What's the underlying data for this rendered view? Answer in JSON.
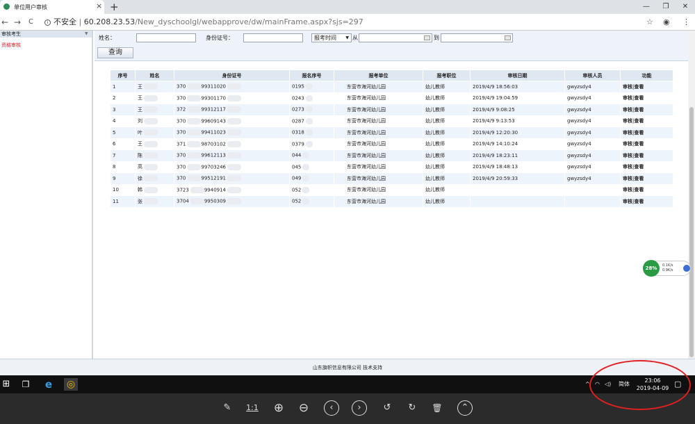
{
  "browser": {
    "tab_title": "单位用户审核",
    "tab_close": "×",
    "new_tab": "+",
    "window_controls": [
      "—",
      "❐",
      "✕"
    ],
    "nav": {
      "back": "←",
      "forward": "→",
      "reload": "C"
    },
    "security_label": "不安全",
    "url_host": "60.208.23.53",
    "url_path": "/New_dyschoolgl/webapprove/dw/mainFrame.aspx?sjs=297",
    "star": "☆",
    "account": "◉",
    "menu": "⋮"
  },
  "sidebar": {
    "header": "审核考生",
    "items": [
      {
        "label": "资格审核"
      }
    ]
  },
  "filters": {
    "name_label": "姓名：",
    "id_label": "身份证号：",
    "time_select": "报考时间",
    "from_label": "从",
    "to_label": "到",
    "query_button": "查询"
  },
  "table": {
    "columns": [
      "序号",
      "姓名",
      "身份证号",
      "报名序号",
      "报考单位",
      "报考职位",
      "审核日期",
      "审核人员",
      "功能"
    ],
    "rows": [
      {
        "no": "1",
        "name": "王",
        "id": "370",
        "id2": "99311020",
        "reg": "0195",
        "unit": "东营市海河幼儿园",
        "pos": "幼儿教师",
        "date": "2019/4/9 18:56:03",
        "auditor": "gwyzsdy4",
        "a1": "审核",
        "a2": "查看"
      },
      {
        "no": "2",
        "name": "王",
        "id": "370",
        "id2": "99301170",
        "reg": "0243",
        "unit": "东营市海河幼儿园",
        "pos": "幼儿教师",
        "date": "2019/4/9 19:04:59",
        "auditor": "gwyzsdy4",
        "a1": "审核",
        "a2": "查看"
      },
      {
        "no": "3",
        "name": "王",
        "id": "372",
        "id2": "99312117",
        "reg": "0273",
        "unit": "东营市海河幼儿园",
        "pos": "幼儿教师",
        "date": "2019/4/9 9:08:25",
        "auditor": "gwyzsdy4",
        "a1": "审核",
        "a2": "查看"
      },
      {
        "no": "4",
        "name": "刘",
        "id": "370",
        "id2": "99609143",
        "reg": "0287",
        "unit": "东营市海河幼儿园",
        "pos": "幼儿教师",
        "date": "2019/4/9 9:13:53",
        "auditor": "gwyzsdy4",
        "a1": "审核",
        "a2": "查看"
      },
      {
        "no": "5",
        "name": "叶",
        "id": "370",
        "id2": "99411023",
        "reg": "0318",
        "unit": "东营市海河幼儿园",
        "pos": "幼儿教师",
        "date": "2019/4/9 12:20:30",
        "auditor": "gwyzsdy4",
        "a1": "审核",
        "a2": "查看"
      },
      {
        "no": "6",
        "name": "王",
        "id": "371",
        "id2": "98703102",
        "reg": "0379",
        "unit": "东营市海河幼儿园",
        "pos": "幼儿教师",
        "date": "2019/4/9 14:10:24",
        "auditor": "gwyzsdy4",
        "a1": "审核",
        "a2": "查看"
      },
      {
        "no": "7",
        "name": "陈",
        "id": "370",
        "id2": "99612113",
        "reg": "044",
        "unit": "东营市海河幼儿园",
        "pos": "幼儿教师",
        "date": "2019/4/9 18:23:11",
        "auditor": "gwyzsdy4",
        "a1": "审核",
        "a2": "查看"
      },
      {
        "no": "8",
        "name": "高",
        "id": "370",
        "id2": "99703246",
        "reg": "045",
        "unit": "东营市海河幼儿园",
        "pos": "幼儿教师",
        "date": "2019/4/9 18:48:13",
        "auditor": "gwyzsdy4",
        "a1": "审核",
        "a2": "查看"
      },
      {
        "no": "9",
        "name": "徐",
        "id": "370",
        "id2": "99512191",
        "reg": "049",
        "unit": "东营市海河幼儿园",
        "pos": "幼儿教师",
        "date": "2019/4/9 20:59:33",
        "auditor": "gwyzsdy4",
        "a1": "审核",
        "a2": "查看"
      },
      {
        "no": "10",
        "name": "韩",
        "id": "3723",
        "id2": "9940914",
        "reg": "052",
        "unit": "东营市海河幼儿园",
        "pos": "幼儿教师",
        "date": "",
        "auditor": "",
        "a1": "审核",
        "a2": "查看"
      },
      {
        "no": "11",
        "name": "张",
        "id": "3704",
        "id2": "9950309",
        "reg": "052",
        "unit": "东营市海河幼儿园",
        "pos": "幼儿教师",
        "date": "",
        "auditor": "",
        "a1": "审核",
        "a2": "查看"
      }
    ]
  },
  "footer": {
    "text": "山东旗帜信息有限公司 技术支持"
  },
  "net_widget": {
    "percent": "28%",
    "up": "0.1K/s",
    "down": "0.9K/s"
  },
  "taskbar": {
    "ime": "简体",
    "time": "23:06",
    "date": "2019-04-09",
    "start": "⊞",
    "task_view": "❐",
    "edge": "e",
    "chrome": "◎",
    "tray_up": "^",
    "tray_net": "◠",
    "tray_vol": "◁)",
    "notify": "▢"
  },
  "viewer": {
    "edit": "✎",
    "actual": "1:1",
    "zoom_in": "⊕",
    "zoom_out": "⊖",
    "prev": "‹",
    "next": "›",
    "rot_left": "↺",
    "rot_right": "↻",
    "delete": "🗑",
    "up": "⌃"
  },
  "colors": {
    "accent": "#1a73e8",
    "header_bg": "#dfe7f1",
    "row_alt": "#eef4fb",
    "annotation": "#e02020"
  }
}
